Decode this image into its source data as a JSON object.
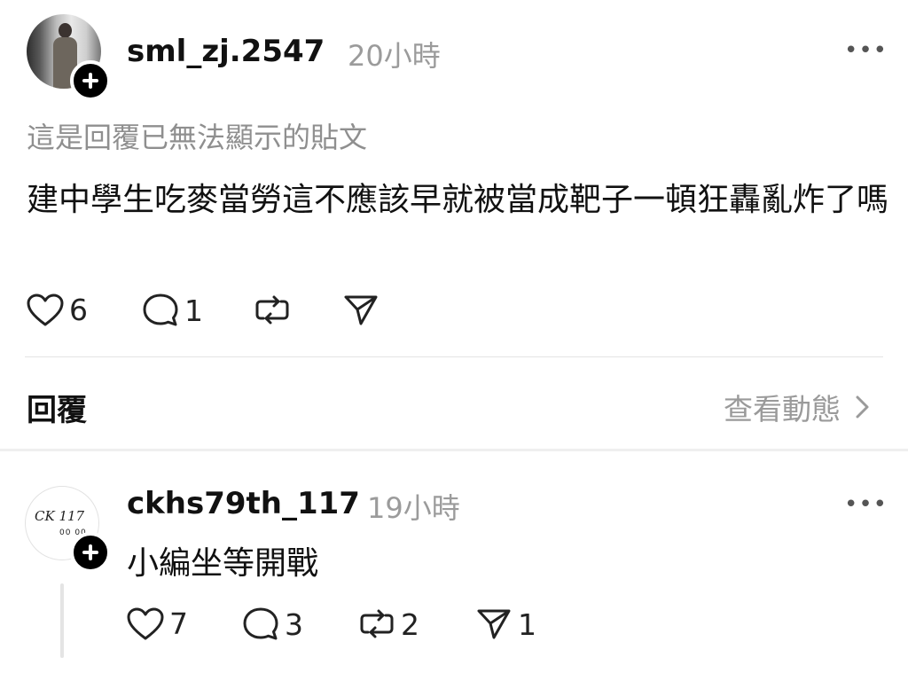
{
  "post": {
    "username": "sml_zj.2547",
    "time": "20小時",
    "more_icon": "ellipsis-icon",
    "context": "這是回覆已無法顯示的貼文",
    "text": "建中學生吃麥當勞這不應該早就被當成靶子一頓狂轟亂炸了嗎",
    "likes": "6",
    "comments": "1"
  },
  "reply_section": {
    "label": "回覆",
    "activity_link": "查看動態"
  },
  "reply": {
    "username": "ckhs79th_117",
    "time": "19小時",
    "avatar_text": "CK 117",
    "avatar_dots": "00 00",
    "text": "小編坐等開戰",
    "likes": "7",
    "comments": "3",
    "reposts": "2",
    "shares": "1"
  }
}
